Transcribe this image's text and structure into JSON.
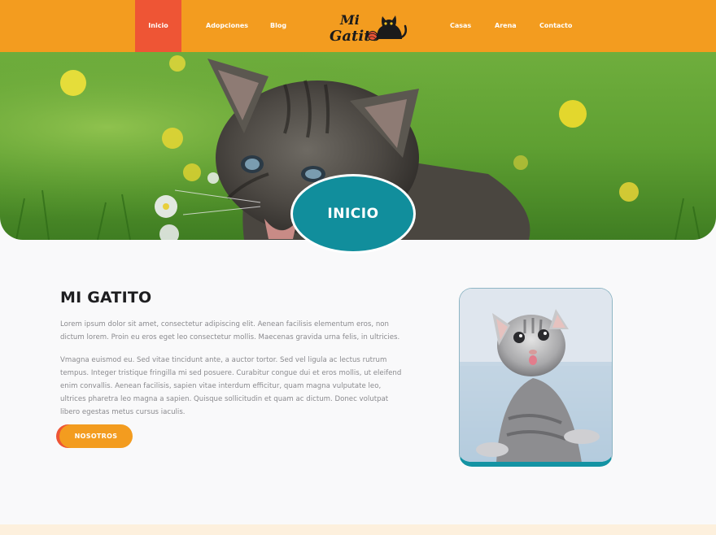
{
  "nav": {
    "items": [
      {
        "label": "Inicio",
        "active": true
      },
      {
        "label": "Adopciones"
      },
      {
        "label": "Blog"
      },
      {
        "label": "Casas"
      },
      {
        "label": "Arena"
      },
      {
        "label": "Contacto"
      }
    ],
    "logo_text_line1": "Mi",
    "logo_text_line2": "Gatito",
    "logo_icon": "black-cat-with-yarn-icon"
  },
  "hero": {
    "badge_label": "INICIO",
    "image": "kitten-in-grass-photo"
  },
  "about": {
    "title": "MI GATITO",
    "paragraph1": "Lorem ipsum dolor sit amet, consectetur adipiscing elit. Aenean facilisis elementum eros, non dictum lorem. Proin eu eros eget leo consectetur mollis. Maecenas gravida urna felis, in ultricies.",
    "paragraph2": "Vmagna euismod eu. Sed vitae tincidunt ante, a auctor tortor. Sed vel ligula ac lectus rutrum tempus. Integer tristique fringilla mi sed posuere. Curabitur congue dui et eros mollis, ut eleifend enim convallis. Aenean facilisis, sapien vitae interdum efficitur, quam magna vulputate leo, ultrices pharetra leo magna a sapien. Quisque sollicitudin et quam ac dictum. Donec volutpat libero egestas metus cursus iaculis.",
    "button_label": "NOSOTROS",
    "image": "grey-kitten-photo"
  },
  "colors": {
    "nav_bg": "#f39c1f",
    "nav_active": "#ee5535",
    "badge": "#118e9c",
    "frame_accent": "#1493a3"
  }
}
